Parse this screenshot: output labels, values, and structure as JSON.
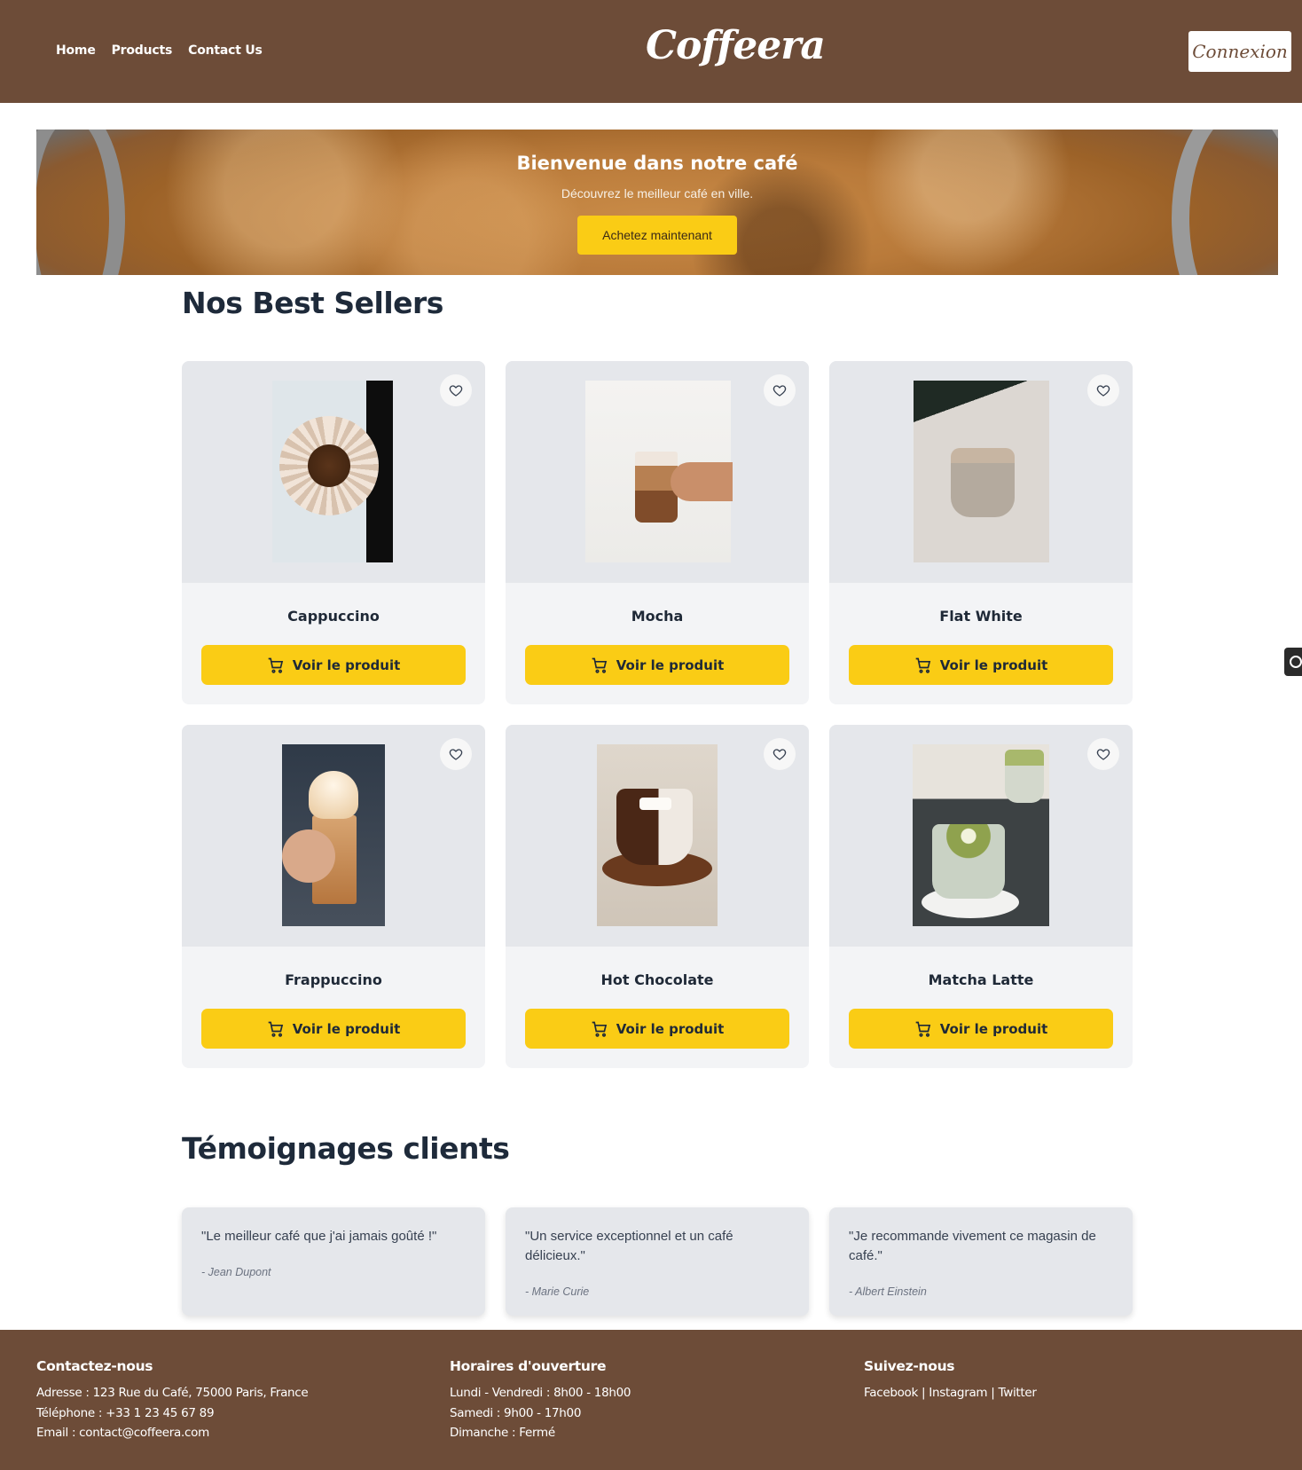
{
  "nav": {
    "items": [
      "Home",
      "Products",
      "Contact Us"
    ]
  },
  "brand": {
    "name": "Coffeera",
    "color": "#6d4c38",
    "accent": "#facc15"
  },
  "header": {
    "login_label": "Connexion"
  },
  "hero": {
    "title": "Bienvenue dans notre café",
    "subtitle": "Découvrez le meilleur café en ville.",
    "cta": "Achetez maintenant"
  },
  "best_sellers": {
    "title": "Nos Best Sellers",
    "button_label": "Voir le produit",
    "products": [
      {
        "name": "Cappuccino"
      },
      {
        "name": "Mocha"
      },
      {
        "name": "Flat White"
      },
      {
        "name": "Frappuccino"
      },
      {
        "name": "Hot Chocolate"
      },
      {
        "name": "Matcha Latte"
      }
    ]
  },
  "testimonials": {
    "title": "Témoignages clients",
    "items": [
      {
        "quote": "\"Le meilleur café que j'ai jamais goûté !\"",
        "author": "- Jean Dupont"
      },
      {
        "quote": "\"Un service exceptionnel et un café délicieux.\"",
        "author": "- Marie Curie"
      },
      {
        "quote": "\"Je recommande vivement ce magasin de café.\"",
        "author": "- Albert Einstein"
      }
    ]
  },
  "footer": {
    "contact": {
      "title": "Contactez-nous",
      "address": "Adresse : 123 Rue du Café, 75000 Paris, France",
      "phone": "Téléphone : +33 1 23 45 67 89",
      "email": "Email : contact@coffeera.com"
    },
    "hours": {
      "title": "Horaires d'ouverture",
      "weekdays": "Lundi - Vendredi : 8h00 - 18h00",
      "saturday": "Samedi : 9h00 - 17h00",
      "sunday": "Dimanche : Fermé"
    },
    "social": {
      "title": "Suivez-nous",
      "links": [
        "Facebook",
        "Instagram",
        "Twitter"
      ],
      "separator": "|"
    }
  }
}
